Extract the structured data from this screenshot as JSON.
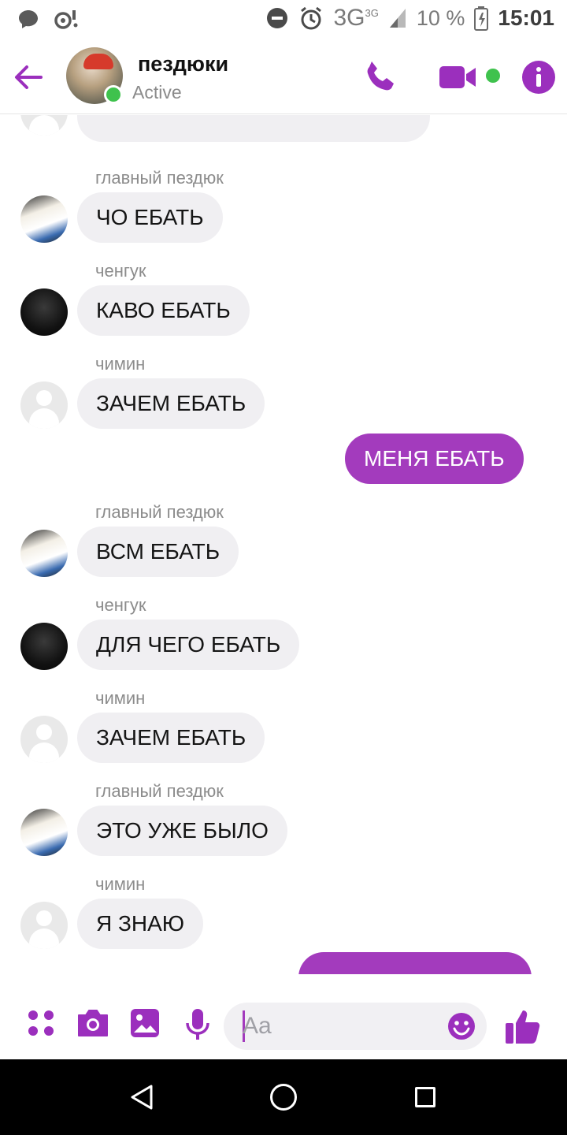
{
  "status_bar": {
    "network": "3G",
    "network_badge": "3G",
    "battery": "10 %",
    "time": "15:01",
    "icons": [
      "chat-bubble-icon",
      "media-icon",
      "dnd-icon",
      "alarm-icon",
      "signal-icon",
      "battery-icon"
    ]
  },
  "header": {
    "title": "пездюки",
    "status": "Active",
    "colors": {
      "accent": "#a33bbd",
      "online": "#3fc24d"
    }
  },
  "messages": [
    {
      "sender": "главный пездюк",
      "text": "ЧО ЕБАТЬ"
    },
    {
      "sender": "ченгук",
      "text": "КАВО ЕБАТЬ"
    },
    {
      "sender": "чимин",
      "text": "ЗАЧЕМ ЕБАТЬ"
    },
    {
      "sender": "",
      "text": "МЕНЯ ЕБАТЬ",
      "mine": true
    },
    {
      "sender": "главный пездюк",
      "text": "ВСМ ЕБАТЬ"
    },
    {
      "sender": "ченгук",
      "text": "ДЛЯ ЧЕГО ЕБАТЬ"
    },
    {
      "sender": "чимин",
      "text": "ЗАЧЕМ ЕБАТЬ"
    },
    {
      "sender": "главный пездюк",
      "text": " ЭТО УЖЕ БЫЛО"
    },
    {
      "sender": "чимин",
      "text": "Я ЗНАЮ"
    }
  ],
  "composer": {
    "placeholder": "Aa",
    "icons": [
      "apps-icon",
      "camera-icon",
      "gallery-icon",
      "mic-icon",
      "emoji-icon",
      "like-icon"
    ]
  },
  "nav": {
    "icons": [
      "back-icon",
      "home-icon",
      "recents-icon"
    ]
  }
}
